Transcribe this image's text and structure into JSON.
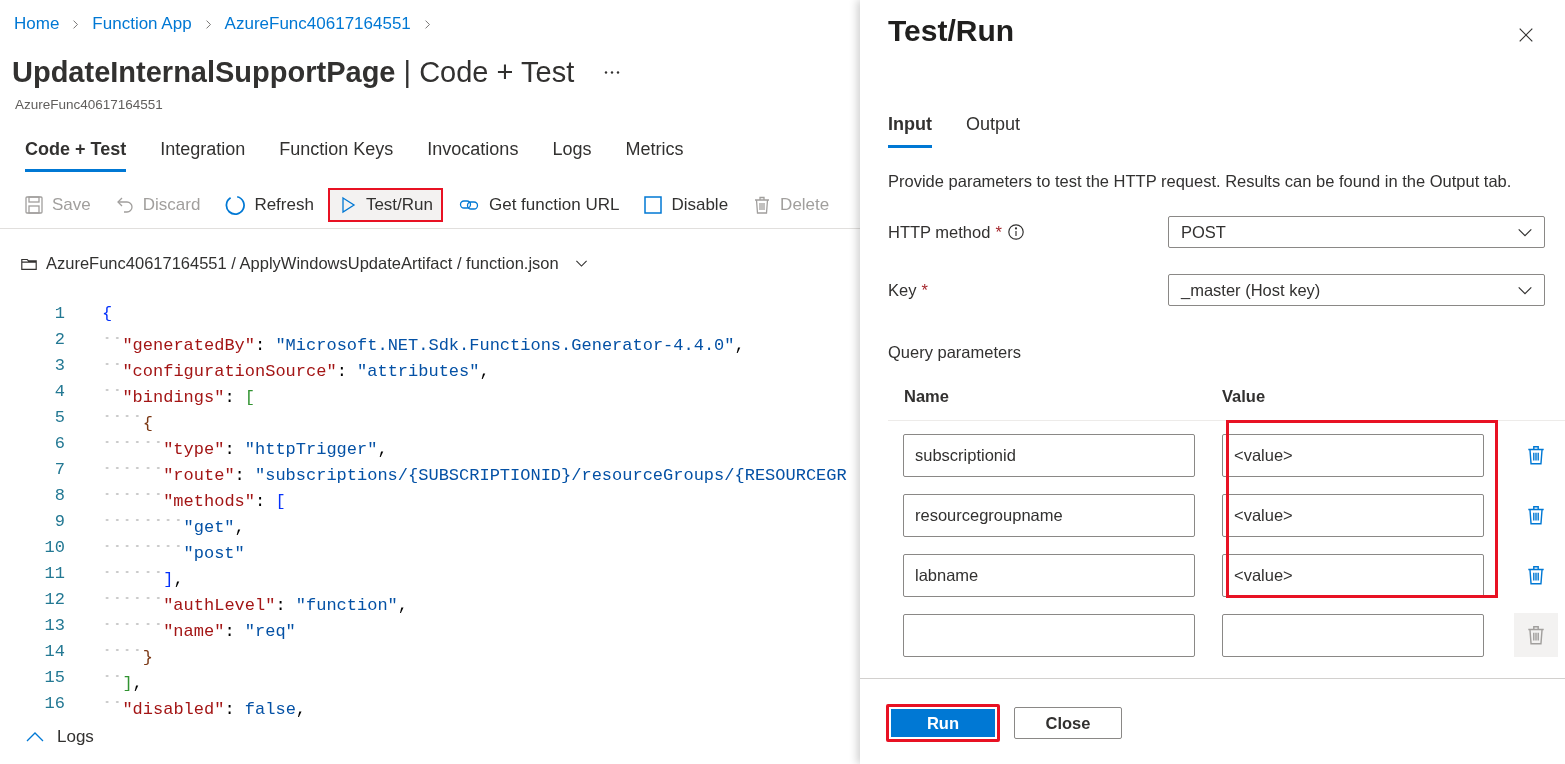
{
  "breadcrumb": [
    {
      "label": "Home"
    },
    {
      "label": "Function App"
    },
    {
      "label": "AzureFunc40617164551"
    }
  ],
  "page": {
    "title": "UpdateInternalSupportPage",
    "separator": "|",
    "section": "Code + Test",
    "subtitle": "AzureFunc40617164551"
  },
  "tabs": [
    {
      "label": "Code + Test",
      "selected": true
    },
    {
      "label": "Integration",
      "selected": false
    },
    {
      "label": "Function Keys",
      "selected": false
    },
    {
      "label": "Invocations",
      "selected": false
    },
    {
      "label": "Logs",
      "selected": false
    },
    {
      "label": "Metrics",
      "selected": false
    }
  ],
  "toolbar": [
    {
      "kind": "save",
      "label": "Save",
      "disabled": true,
      "highlighted": false
    },
    {
      "kind": "discard",
      "label": "Discard",
      "disabled": true,
      "highlighted": false
    },
    {
      "kind": "refresh",
      "label": "Refresh",
      "disabled": false,
      "highlighted": false
    },
    {
      "kind": "run",
      "label": "Test/Run",
      "disabled": false,
      "highlighted": true
    },
    {
      "kind": "link",
      "label": "Get function URL",
      "disabled": false,
      "highlighted": false
    },
    {
      "kind": "checkbox",
      "label": "Disable",
      "disabled": false,
      "highlighted": false
    },
    {
      "kind": "delete",
      "label": "Delete",
      "disabled": true,
      "highlighted": false
    }
  ],
  "file_path": "AzureFunc40617164551 / ApplyWindowsUpdateArtifact / function.json",
  "code": {
    "lines": [
      {
        "number": "1",
        "tokens": [
          {
            "kind": "bracket-1",
            "text": "{"
          }
        ]
      },
      {
        "number": "2",
        "tokens": [
          {
            "kind": "indent"
          },
          {
            "kind": "key",
            "text": "\"generatedBy\""
          },
          {
            "kind": "punct",
            "text": ": "
          },
          {
            "kind": "string",
            "text": "\"Microsoft.NET.Sdk.Functions.Generator-4.4.0\""
          },
          {
            "kind": "punct",
            "text": ","
          }
        ]
      },
      {
        "number": "3",
        "tokens": [
          {
            "kind": "indent"
          },
          {
            "kind": "key",
            "text": "\"configurationSource\""
          },
          {
            "kind": "punct",
            "text": ": "
          },
          {
            "kind": "string",
            "text": "\"attributes\""
          },
          {
            "kind": "punct",
            "text": ","
          }
        ]
      },
      {
        "number": "4",
        "tokens": [
          {
            "kind": "indent"
          },
          {
            "kind": "key",
            "text": "\"bindings\""
          },
          {
            "kind": "punct",
            "text": ": "
          },
          {
            "kind": "bracket-2",
            "text": "["
          }
        ]
      },
      {
        "number": "5",
        "tokens": [
          {
            "kind": "indent"
          },
          {
            "kind": "indent"
          },
          {
            "kind": "bracket-3",
            "text": "{"
          }
        ]
      },
      {
        "number": "6",
        "tokens": [
          {
            "kind": "indent"
          },
          {
            "kind": "indent"
          },
          {
            "kind": "indent"
          },
          {
            "kind": "key",
            "text": "\"type\""
          },
          {
            "kind": "punct",
            "text": ": "
          },
          {
            "kind": "string",
            "text": "\"httpTrigger\""
          },
          {
            "kind": "punct",
            "text": ","
          }
        ]
      },
      {
        "number": "7",
        "tokens": [
          {
            "kind": "indent"
          },
          {
            "kind": "indent"
          },
          {
            "kind": "indent"
          },
          {
            "kind": "key",
            "text": "\"route\""
          },
          {
            "kind": "punct",
            "text": ": "
          },
          {
            "kind": "string",
            "text": "\"subscriptions/{SUBSCRIPTIONID}/resourceGroups/{RESOURCEGR"
          }
        ]
      },
      {
        "number": "8",
        "tokens": [
          {
            "kind": "indent"
          },
          {
            "kind": "indent"
          },
          {
            "kind": "indent"
          },
          {
            "kind": "key",
            "text": "\"methods\""
          },
          {
            "kind": "punct",
            "text": ": "
          },
          {
            "kind": "bracket-1",
            "text": "["
          }
        ]
      },
      {
        "number": "9",
        "tokens": [
          {
            "kind": "indent"
          },
          {
            "kind": "indent"
          },
          {
            "kind": "indent"
          },
          {
            "kind": "indent"
          },
          {
            "kind": "string",
            "text": "\"get\""
          },
          {
            "kind": "punct",
            "text": ","
          }
        ]
      },
      {
        "number": "10",
        "tokens": [
          {
            "kind": "indent"
          },
          {
            "kind": "indent"
          },
          {
            "kind": "indent"
          },
          {
            "kind": "indent"
          },
          {
            "kind": "string",
            "text": "\"post\""
          }
        ]
      },
      {
        "number": "11",
        "tokens": [
          {
            "kind": "indent"
          },
          {
            "kind": "indent"
          },
          {
            "kind": "indent"
          },
          {
            "kind": "bracket-1",
            "text": "]"
          },
          {
            "kind": "punct",
            "text": ","
          }
        ]
      },
      {
        "number": "12",
        "tokens": [
          {
            "kind": "indent"
          },
          {
            "kind": "indent"
          },
          {
            "kind": "indent"
          },
          {
            "kind": "key",
            "text": "\"authLevel\""
          },
          {
            "kind": "punct",
            "text": ": "
          },
          {
            "kind": "string",
            "text": "\"function\""
          },
          {
            "kind": "punct",
            "text": ","
          }
        ]
      },
      {
        "number": "13",
        "tokens": [
          {
            "kind": "indent"
          },
          {
            "kind": "indent"
          },
          {
            "kind": "indent"
          },
          {
            "kind": "key",
            "text": "\"name\""
          },
          {
            "kind": "punct",
            "text": ": "
          },
          {
            "kind": "string",
            "text": "\"req\""
          }
        ]
      },
      {
        "number": "14",
        "tokens": [
          {
            "kind": "indent"
          },
          {
            "kind": "indent"
          },
          {
            "kind": "bracket-3",
            "text": "}"
          }
        ]
      },
      {
        "number": "15",
        "tokens": [
          {
            "kind": "indent"
          },
          {
            "kind": "bracket-2",
            "text": "]"
          },
          {
            "kind": "punct",
            "text": ","
          }
        ]
      },
      {
        "number": "16",
        "tokens": [
          {
            "kind": "indent"
          },
          {
            "kind": "key",
            "text": "\"disabled\""
          },
          {
            "kind": "punct",
            "text": ": "
          },
          {
            "kind": "keyword",
            "text": "false"
          },
          {
            "kind": "punct",
            "text": ","
          }
        ]
      }
    ]
  },
  "logs": {
    "label": "Logs",
    "expanded": false
  },
  "panel": {
    "title": "Test/Run",
    "tabs": [
      {
        "label": "Input",
        "selected": true
      },
      {
        "label": "Output",
        "selected": false
      }
    ],
    "description": "Provide parameters to test the HTTP request. Results can be found in the Output tab.",
    "fields": [
      {
        "label": "HTTP method",
        "required_mark": "*",
        "info": true,
        "value": "POST"
      },
      {
        "label": "Key",
        "required_mark": "*",
        "info": false,
        "value": "_master (Host key)"
      }
    ],
    "query": {
      "label": "Query parameters",
      "columns": [
        "Name",
        "Value"
      ],
      "value_column_highlighted": true,
      "rows": [
        {
          "name": "subscriptionid",
          "value": "<value>",
          "delete_disabled": false
        },
        {
          "name": "resourcegroupname",
          "value": "<value>",
          "delete_disabled": false
        },
        {
          "name": "labname",
          "value": "<value>",
          "delete_disabled": false
        },
        {
          "delete_disabled": true
        }
      ]
    },
    "buttons": [
      {
        "kind": "primary",
        "label": "Run",
        "highlighted": true
      },
      {
        "kind": "secondary",
        "label": "Close",
        "highlighted": false
      }
    ]
  }
}
